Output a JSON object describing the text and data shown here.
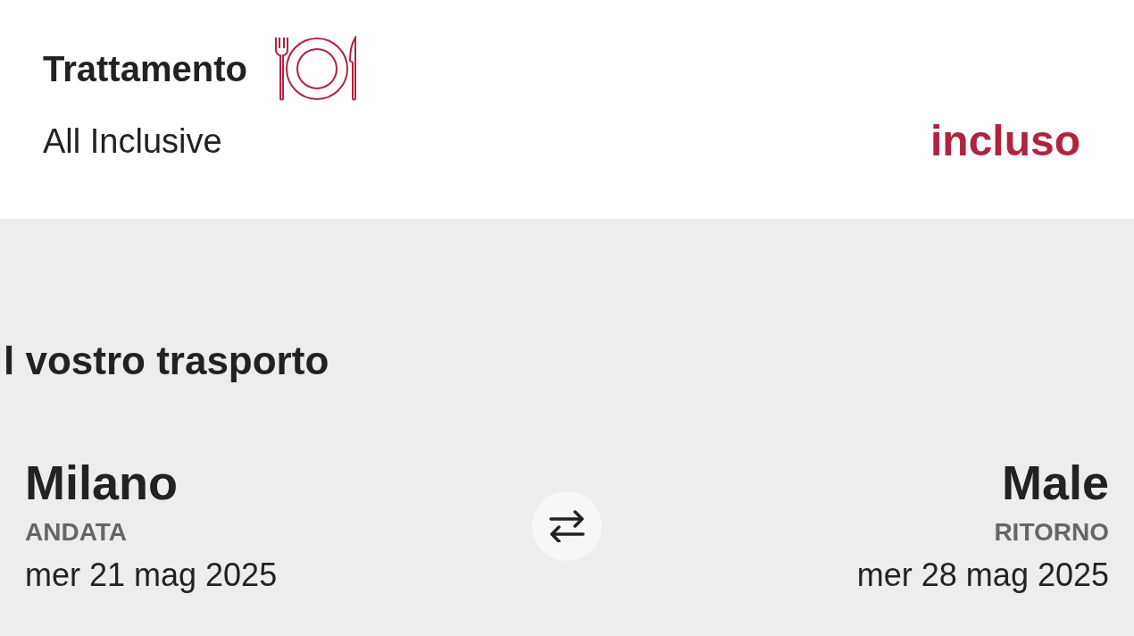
{
  "board": {
    "title": "Trattamento",
    "value": "All Inclusive",
    "price": "incluso"
  },
  "transport": {
    "title": "l vostro trasporto",
    "legs": [
      {
        "city": "Milano",
        "label": "ANDATA",
        "date": "mer 21 mag 2025"
      },
      {
        "city": "Male",
        "label": "RITORNO",
        "date": "mer 28 mag 2025"
      }
    ]
  }
}
